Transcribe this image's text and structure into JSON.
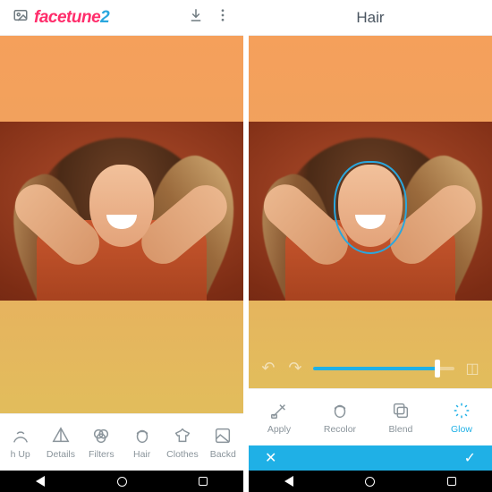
{
  "left": {
    "brand_part1": "facetune",
    "brand_part2": "2",
    "share_icon": "download-icon",
    "menu_icon": "more-vert-icon",
    "tools": [
      {
        "key": "touchup",
        "label": "h Up"
      },
      {
        "key": "details",
        "label": "Details"
      },
      {
        "key": "filters",
        "label": "Filters"
      },
      {
        "key": "hair",
        "label": "Hair"
      },
      {
        "key": "clothes",
        "label": "Clothes"
      },
      {
        "key": "backdrop",
        "label": "Backd"
      }
    ]
  },
  "right": {
    "title": "Hair",
    "slider_value": 88,
    "tools": [
      {
        "key": "apply",
        "label": "Apply"
      },
      {
        "key": "recolor",
        "label": "Recolor"
      },
      {
        "key": "blend",
        "label": "Blend"
      },
      {
        "key": "glow",
        "label": "Glow",
        "selected": true
      }
    ],
    "cancel_glyph": "✕",
    "confirm_glyph": "✓"
  },
  "colors": {
    "accent": "#1fb0e6",
    "brand_pink": "#ff2d6b",
    "brand_blue": "#2aa7de"
  }
}
